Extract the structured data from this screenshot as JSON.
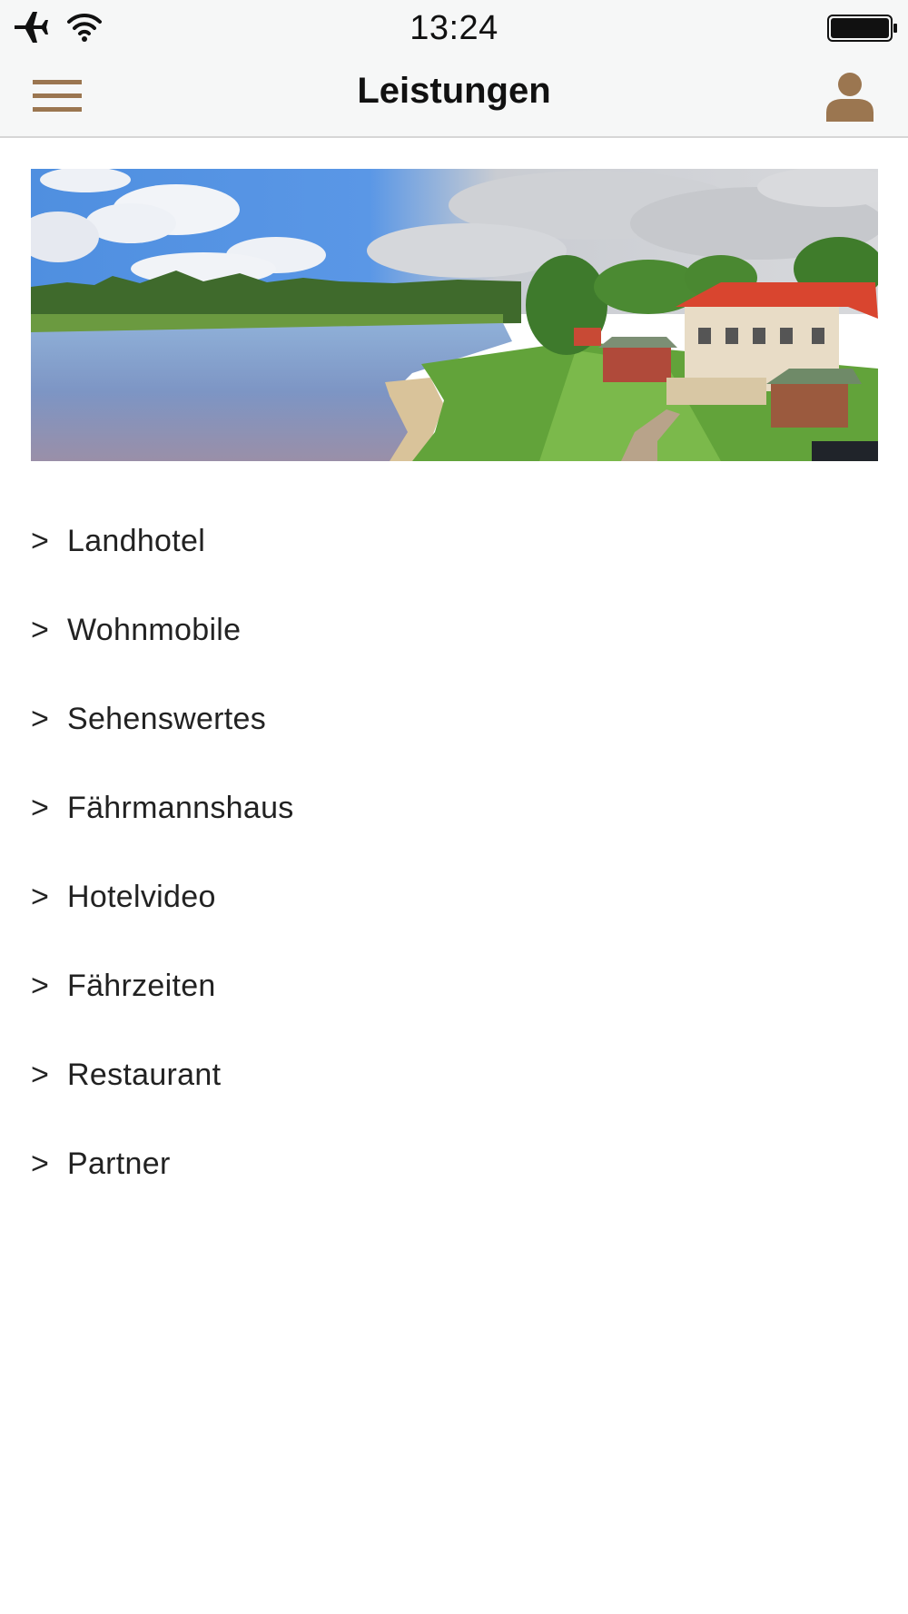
{
  "status_bar": {
    "time": "13:24",
    "icons": [
      "airplane-icon",
      "wifi-icon",
      "battery-icon"
    ]
  },
  "nav": {
    "title": "Leistungen",
    "menu_icon": "hamburger-icon",
    "account_icon": "user-icon",
    "accent_color": "#9b7650"
  },
  "hero": {
    "image": "river-landhotel-panorama"
  },
  "menu": {
    "arrow": ">",
    "items": [
      {
        "label": "Landhotel"
      },
      {
        "label": "Wohnmobile"
      },
      {
        "label": "Sehenswertes"
      },
      {
        "label": "Fährmannshaus"
      },
      {
        "label": "Hotelvideo"
      },
      {
        "label": "Fährzeiten"
      },
      {
        "label": "Restaurant"
      },
      {
        "label": "Partner"
      }
    ]
  }
}
